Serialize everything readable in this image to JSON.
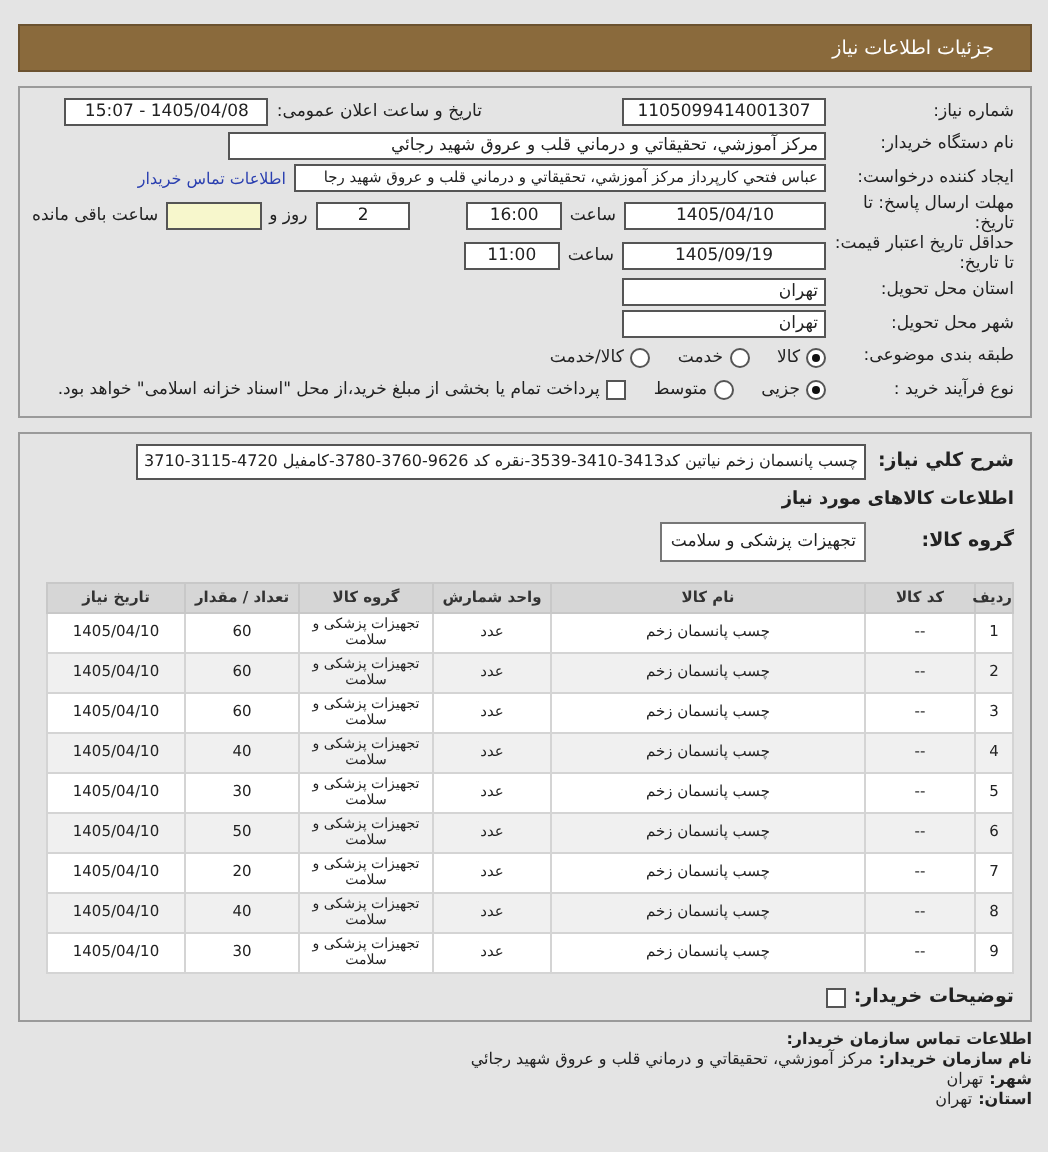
{
  "header": {
    "title": "جزئیات اطلاعات نیاز"
  },
  "details": {
    "need_number": {
      "label": "شماره نیاز:",
      "value": "1105099414001307"
    },
    "announce": {
      "label": "تاریخ و ساعت اعلان عمومی:",
      "value": "1405/04/08 - 15:07"
    },
    "buyer": {
      "label": "نام دستگاه خریدار:",
      "value": "مرکز آموزشي، تحقيقاتي و درماني قلب و عروق شهيد رجائي"
    },
    "creator": {
      "label": "ایجاد کننده درخواست:",
      "value": "عباس فتحي كارپرداز مرکز آموزشي، تحقيقاتي و درماني قلب و عروق شهيد رجا",
      "link": "اطلاعات تماس خریدار"
    },
    "deadline": {
      "label": "مهلت ارسال پاسخ: تا تاریخ:",
      "date": "1405/04/10",
      "time_label": "ساعت",
      "time": "16:00",
      "days": "2",
      "days_label": "روز و",
      "remaining_label": "ساعت باقی مانده"
    },
    "validity": {
      "label": "حداقل تاریخ اعتبار قیمت: تا تاریخ:",
      "date": "1405/09/19",
      "time_label": "ساعت",
      "time": "11:00"
    },
    "province": {
      "label": "استان محل تحویل:",
      "value": "تهران"
    },
    "city": {
      "label": "شهر محل تحویل:",
      "value": "تهران"
    },
    "classification": {
      "label": "طبقه بندی موضوعی:",
      "options": [
        {
          "kind": "radio",
          "label": "کالا",
          "selected": true
        },
        {
          "kind": "radio",
          "label": "خدمت",
          "selected": false
        },
        {
          "kind": "radio",
          "label": "کالا/خدمت",
          "selected": false
        }
      ]
    },
    "process": {
      "label": "نوع فرآیند خرید :",
      "options": [
        {
          "kind": "radio",
          "label": "جزیی",
          "selected": true
        },
        {
          "kind": "radio",
          "label": "متوسط",
          "selected": false
        },
        {
          "kind": "checkbox",
          "label": "پرداخت تمام یا بخشی از مبلغ خرید،از محل \"اسناد خزانه اسلامی\" خواهد بود.",
          "checked": false
        }
      ]
    }
  },
  "needs": {
    "description": {
      "label": "شرح کلي نیاز:",
      "value": "چسب پانسمان زخم نیاتین کد3413-3410-3539-نقره کد 9626-3760-3780-کامفیل 4720-3115-3710"
    },
    "heading": "اطلاعات کالاهای مورد نیاز",
    "group": {
      "label": "گروه کالا:",
      "value": "تجهیزات پزشکی و سلامت"
    },
    "table": {
      "columns": [
        "ردیف",
        "کد کالا",
        "نام کالا",
        "واحد شمارش",
        "گروه کالا",
        "تعداد / مقدار",
        "تاریخ نیاز"
      ],
      "rows": [
        [
          "1",
          "--",
          "چسب پانسمان زخم",
          "عدد",
          "تجهیزات پزشکی و سلامت",
          "60",
          "1405/04/10"
        ],
        [
          "2",
          "--",
          "چسب پانسمان زخم",
          "عدد",
          "تجهیزات پزشکی و سلامت",
          "60",
          "1405/04/10"
        ],
        [
          "3",
          "--",
          "چسب پانسمان زخم",
          "عدد",
          "تجهیزات پزشکی و سلامت",
          "60",
          "1405/04/10"
        ],
        [
          "4",
          "--",
          "چسب پانسمان زخم",
          "عدد",
          "تجهیزات پزشکی و سلامت",
          "40",
          "1405/04/10"
        ],
        [
          "5",
          "--",
          "چسب پانسمان زخم",
          "عدد",
          "تجهیزات پزشکی و سلامت",
          "30",
          "1405/04/10"
        ],
        [
          "6",
          "--",
          "چسب پانسمان زخم",
          "عدد",
          "تجهیزات پزشکی و سلامت",
          "50",
          "1405/04/10"
        ],
        [
          "7",
          "--",
          "چسب پانسمان زخم",
          "عدد",
          "تجهیزات پزشکی و سلامت",
          "20",
          "1405/04/10"
        ],
        [
          "8",
          "--",
          "چسب پانسمان زخم",
          "عدد",
          "تجهیزات پزشکی و سلامت",
          "40",
          "1405/04/10"
        ],
        [
          "9",
          "--",
          "چسب پانسمان زخم",
          "عدد",
          "تجهیزات پزشکی و سلامت",
          "30",
          "1405/04/10"
        ]
      ]
    },
    "notes": {
      "label": "توضیحات خریدار:",
      "checked": false
    }
  },
  "contact": {
    "heading": "اطلاعات تماس سازمان خریدار:",
    "lines": [
      {
        "label": "نام سازمان خریدار:",
        "value": "مرکز آموزشي، تحقيقاتي و درماني قلب و عروق شهيد رجائي"
      },
      {
        "label": "شهر:",
        "value": "تهران"
      },
      {
        "label": "استان:",
        "value": "تهران"
      }
    ]
  }
}
